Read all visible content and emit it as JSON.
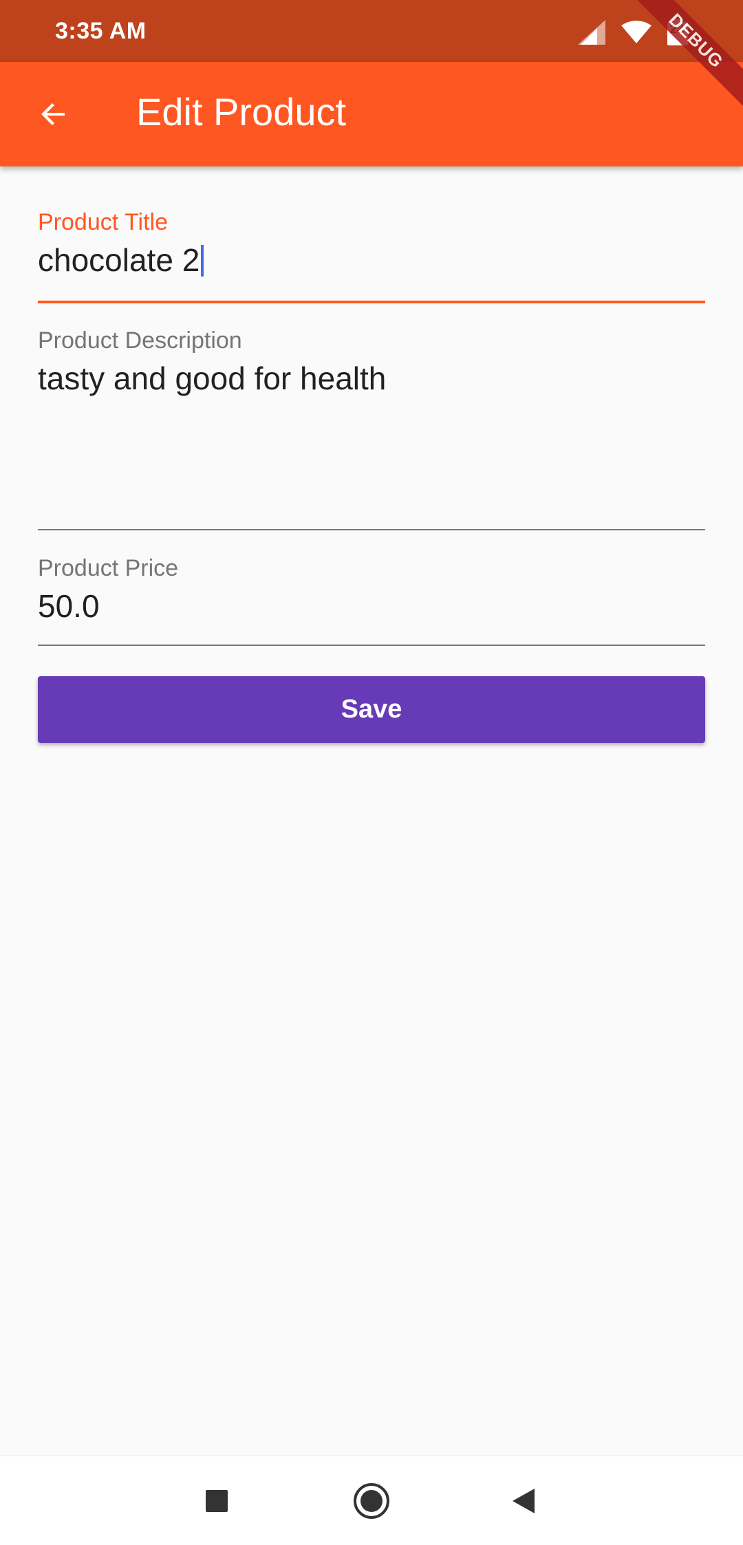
{
  "status_bar": {
    "time": "3:35 AM",
    "battery_level": "23",
    "background": "#be421c"
  },
  "app_bar": {
    "title": "Edit Product",
    "back_icon": "arrow-left-icon",
    "background": "#ff5722"
  },
  "debug_banner": {
    "label": "DEBUG"
  },
  "form": {
    "title_field": {
      "label": "Product Title",
      "value": "chocolate 2",
      "focused": true
    },
    "description_field": {
      "label": "Product Description",
      "value": "tasty and good for health"
    },
    "price_field": {
      "label": "Product Price",
      "value": "50.0"
    },
    "save_button": {
      "label": "Save",
      "color": "#673ab7"
    }
  },
  "nav_bar": {
    "recent_icon": "square-recents-icon",
    "home_icon": "circle-home-icon",
    "back_icon": "triangle-back-icon"
  },
  "colors": {
    "accent": "#ff5722",
    "primary_button": "#673ab7",
    "label_inactive": "#757575",
    "text": "#212121",
    "cursor": "#3f6fe0"
  }
}
